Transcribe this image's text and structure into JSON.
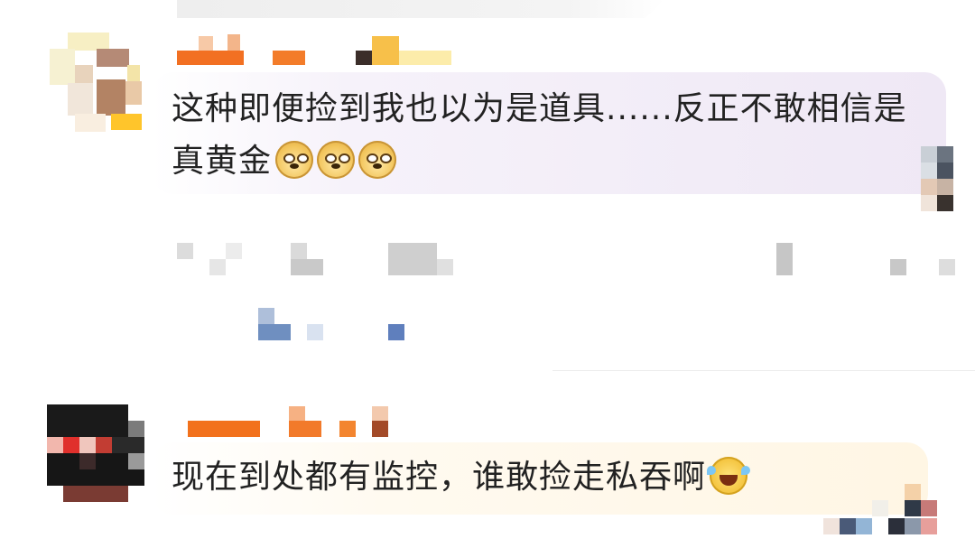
{
  "comments": [
    {
      "text": "这种即便捡到我也以为是道具......反正不敢相信是真黄金",
      "emojis": [
        "doge-icon",
        "doge-icon",
        "doge-icon"
      ],
      "avatar": "pixelated",
      "username": "pixelated"
    },
    {
      "text": "现在到处都有监控，谁敢捡走私吞啊",
      "emojis": [
        "laugh-cry-icon"
      ],
      "avatar": "pixelated",
      "username": "pixelated"
    }
  ],
  "colors": {
    "username_orange": "#f2711c",
    "bubble_1": "#efe8f5",
    "bubble_2": "#fff6e4"
  }
}
